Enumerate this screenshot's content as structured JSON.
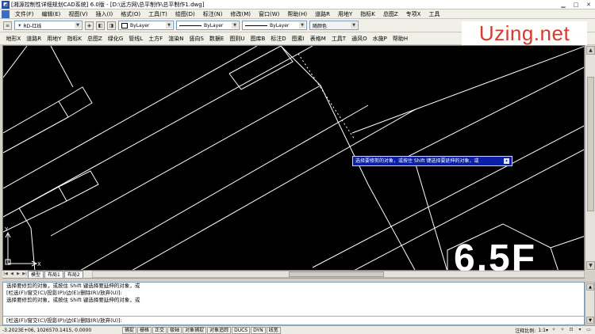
{
  "window": {
    "title": "[湘源控制性详细规划CAD系统] 6.0版 - [D:\\远方网\\总平制作\\总平制作1.dwg]",
    "app_icon": "cad-app-icon",
    "minimize": "▁",
    "maximize": "□",
    "close": "✕"
  },
  "menubar": {
    "items": [
      "文件(F)",
      "编辑(E)",
      "视图(V)",
      "插入(I)",
      "格式(O)",
      "工具(T)",
      "绘图(D)",
      "标注(N)",
      "修改(M)",
      "窗口(W)",
      "帮助(H)",
      "道路R",
      "用地Y",
      "指标K",
      "总图Z",
      "专项X",
      "工具"
    ]
  },
  "toolbar1": {
    "layer_name": "RD-红线",
    "color_value": "ByLayer",
    "linetype_value": "ByLayer",
    "lineweight_value": "ByLayer",
    "plotstyle_value": "随颜色"
  },
  "toolbar2": {
    "items": [
      "地形X",
      "道路R",
      "用地Y",
      "指标K",
      "总图Z",
      "绿化G",
      "管线L",
      "土方F",
      "渲染N",
      "竖向S",
      "数据E",
      "图则U",
      "图库B",
      "标注D",
      "图素I",
      "表格M",
      "工具T",
      "通风O",
      "水施P",
      "帮助H"
    ]
  },
  "watermark": {
    "text": "Uzing.net"
  },
  "canvas": {
    "tooltip_text": "选择要修剪的对象，或按住 Shift 键选择要延伸的对象，或",
    "big_label": "6.5F",
    "ucs_x": "X",
    "ucs_y": "Y"
  },
  "layout_tabs": {
    "tabs": [
      "模型",
      "布局1",
      "布局2"
    ]
  },
  "command": {
    "lines": [
      "选择要修剪的对象，或按住 Shift 键选择要延伸的对象，或",
      "[栏选(F)/窗交(C)/投影(P)/边(E)/删除(R)/放弃(U)]:",
      "选择要修剪的对象，或按住 Shift 键选择要延伸的对象，或"
    ],
    "current_input": "[栏选(F)/窗交(C)/投影(P)/边(E)/删除(R)/放弃(U)]:"
  },
  "statusbar": {
    "coords": "-3.2023E+06, 1026570.1415, 0.0000",
    "toggles": [
      "捕捉",
      "栅格",
      "正交",
      "极轴",
      "对象捕捉",
      "对象追踪",
      "DUCS",
      "DYN",
      "线宽"
    ],
    "annotation_scale_label": "注释比例:",
    "annotation_scale_value": "1:1▾"
  }
}
